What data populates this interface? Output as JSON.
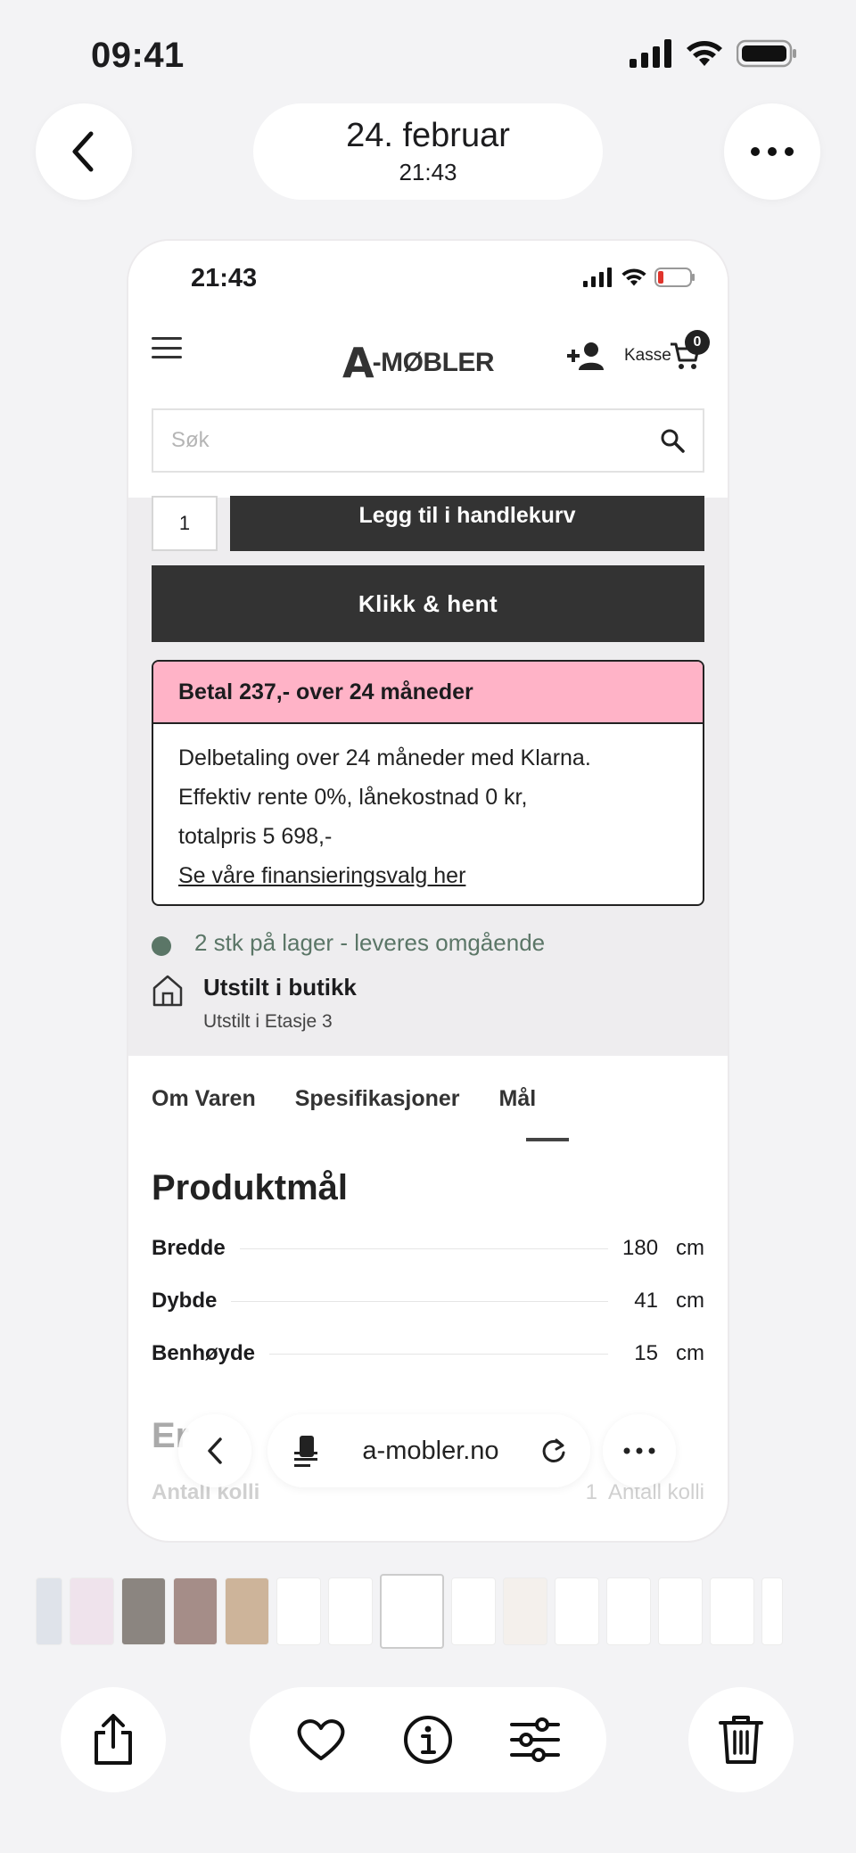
{
  "status_bar": {
    "time": "09:41"
  },
  "header": {
    "date": "24. februar",
    "time": "21:43"
  },
  "screenshot": {
    "status_time": "21:43",
    "logo": {
      "mark": "A",
      "text": "-MØBLER"
    },
    "kasse_label": "Kasse",
    "cart_count": "0",
    "search_placeholder": "Søk",
    "quantity": "1",
    "add_to_cart_label": "Legg til i handlekurv",
    "click_collect_label": "Klikk & hent",
    "klarna": {
      "title": "Betal 237,- over 24 måneder",
      "line1": "Delbetaling over 24 måneder med Klarna.",
      "line2": "Effektiv rente 0%, lånekostnad 0 kr,",
      "line3": "totalpris 5 698,-",
      "link": "Se våre finansieringsvalg her",
      "accent": "#ffb3c7"
    },
    "stock_text": "2 stk på lager - leveres omgående",
    "stock_color": "#5b7667",
    "store": {
      "title": "Utstilt i butikk",
      "subtitle": "Utstilt i Etasje 3"
    },
    "tabs": [
      "Om Varen",
      "Spesifikasjoner",
      "Mål"
    ],
    "active_tab": "Mål",
    "dimensions_title": "Produktmål",
    "dimensions": [
      {
        "label": "Bredde",
        "value": "180",
        "unit": "cm"
      },
      {
        "label": "Dybde",
        "value": "41",
        "unit": "cm"
      },
      {
        "label": "Benhøyde",
        "value": "15",
        "unit": "cm"
      }
    ],
    "partial_heading": "Er",
    "partial_row": {
      "label": "Antall kolli",
      "value": "1",
      "right": "Antall kolli"
    },
    "browser_url": "a-mobler.no"
  },
  "icons": {
    "back": "chevron-left-icon",
    "more": "ellipsis-icon",
    "share": "share-icon",
    "favorite": "heart-icon",
    "info": "info-icon",
    "adjust": "sliders-icon",
    "delete": "trash-icon"
  }
}
